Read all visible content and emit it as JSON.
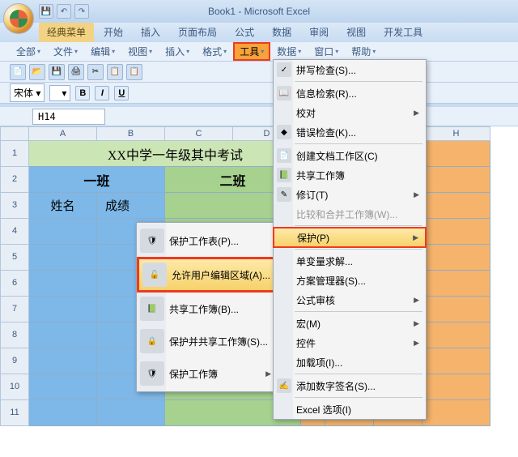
{
  "title": "Book1 - Microsoft Excel",
  "qat": {
    "save": "💾",
    "undo": "↶",
    "redo": "↷"
  },
  "tabs": [
    "经典菜单",
    "开始",
    "插入",
    "页面布局",
    "公式",
    "数据",
    "审阅",
    "视图",
    "开发工具"
  ],
  "active_tab": 0,
  "menubar": [
    "全部",
    "文件",
    "编辑",
    "视图",
    "插入",
    "格式",
    "工具",
    "数据",
    "窗口",
    "帮助"
  ],
  "active_menu": 6,
  "fontbox": "宋体",
  "namebox": "H14",
  "columns": [
    "A",
    "B",
    "C",
    "D",
    "E",
    "F",
    "G",
    "H"
  ],
  "row_numbers": [
    "1",
    "2",
    "3",
    "4",
    "5",
    "6",
    "7",
    "8",
    "9",
    "10",
    "11"
  ],
  "cells": {
    "title_prefix": "XX中学一",
    "title_suffix": "年级其中考试",
    "class1": "一班",
    "class2": "二班",
    "name_hdr": "姓名",
    "score_hdr": "成绩"
  },
  "tools_menu": [
    {
      "label": "拼写检查(S)...",
      "icon": "✓"
    },
    {
      "label": "信息检索(R)...",
      "icon": "📖"
    },
    {
      "label": "校对",
      "icon": "",
      "arrow": true
    },
    {
      "label": "错误检查(K)...",
      "icon": "◆"
    },
    {
      "label": "创建文档工作区(C)",
      "icon": "📄"
    },
    {
      "label": "共享工作簿",
      "icon": "📗"
    },
    {
      "label": "修订(T)",
      "icon": "✎",
      "arrow": true
    },
    {
      "label": "比较和合并工作簿(W)...",
      "icon": "",
      "disabled": true
    },
    {
      "label": "保护(P)",
      "icon": "",
      "arrow": true,
      "highlight": true
    },
    {
      "label": "单变量求解...",
      "icon": ""
    },
    {
      "label": "方案管理器(S)...",
      "icon": ""
    },
    {
      "label": "公式审核",
      "icon": "",
      "arrow": true
    },
    {
      "label": "宏(M)",
      "icon": "",
      "arrow": true
    },
    {
      "label": "控件",
      "icon": "",
      "arrow": true
    },
    {
      "label": "加载项(I)...",
      "icon": ""
    },
    {
      "label": "添加数字签名(S)...",
      "icon": "✍"
    },
    {
      "label": "Excel 选项(I)",
      "icon": ""
    }
  ],
  "protect_menu": [
    {
      "label": "保护工作表(P)...",
      "icon": "🛡"
    },
    {
      "label": "允许用户编辑区域(A)...",
      "icon": "🔓",
      "highlight": true
    },
    {
      "label": "共享工作簿(B)...",
      "icon": "📗"
    },
    {
      "label": "保护并共享工作簿(S)...",
      "icon": "🔒"
    },
    {
      "label": "保护工作簿",
      "icon": "🛡",
      "arrow": true
    }
  ]
}
